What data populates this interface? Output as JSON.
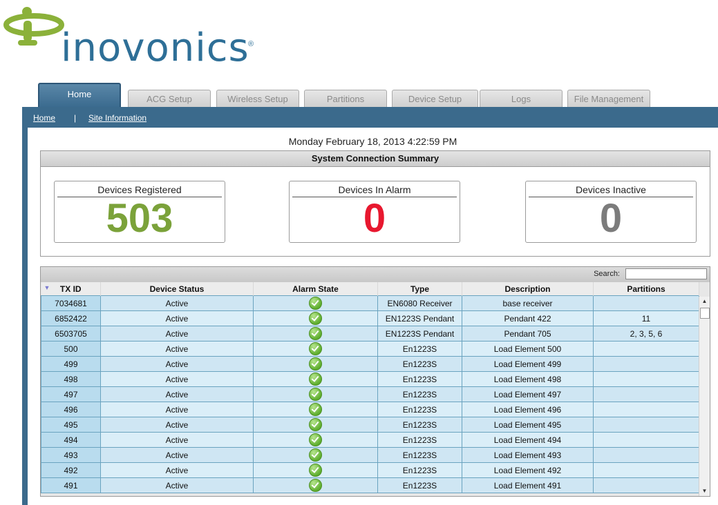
{
  "brand": {
    "name": "inovonics",
    "registered": "®",
    "primary_color": "#2e6f97",
    "accent_color": "#8bb13a"
  },
  "tabs": [
    {
      "label": "Home",
      "active": true
    },
    {
      "label": "ACG Setup"
    },
    {
      "label": "Wireless Setup"
    },
    {
      "label": "Partitions"
    },
    {
      "label": "Device Setup"
    },
    {
      "label": "Logs"
    },
    {
      "label": "File Management"
    }
  ],
  "breadcrumb": {
    "home": "Home",
    "separator": "|",
    "site_information": "Site Information"
  },
  "datetime": "Monday February 18, 2013   4:22:59 PM",
  "summary": {
    "title": "System Connection Summary",
    "cards": [
      {
        "title": "Devices Registered",
        "value": "503",
        "color": "#7ba23a"
      },
      {
        "title": "Devices In Alarm",
        "value": "0",
        "color": "#e8182f"
      },
      {
        "title": "Devices Inactive",
        "value": "0",
        "color": "#7c7c7c"
      }
    ]
  },
  "table": {
    "search_label": "Search:",
    "search_value": "",
    "columns": [
      "TX ID",
      "Device Status",
      "Alarm State",
      "Type",
      "Description",
      "Partitions"
    ],
    "rows": [
      [
        "7034681",
        "Active",
        "ok",
        "EN6080 Receiver",
        "base receiver",
        ""
      ],
      [
        "6852422",
        "Active",
        "ok",
        "EN1223S Pendant",
        "Pendant 422",
        "11"
      ],
      [
        "6503705",
        "Active",
        "ok",
        "EN1223S Pendant",
        "Pendant 705",
        "2, 3, 5, 6"
      ],
      [
        "500",
        "Active",
        "ok",
        "En1223S",
        "Load Element 500",
        ""
      ],
      [
        "499",
        "Active",
        "ok",
        "En1223S",
        "Load Element 499",
        ""
      ],
      [
        "498",
        "Active",
        "ok",
        "En1223S",
        "Load Element 498",
        ""
      ],
      [
        "497",
        "Active",
        "ok",
        "En1223S",
        "Load Element 497",
        ""
      ],
      [
        "496",
        "Active",
        "ok",
        "En1223S",
        "Load Element 496",
        ""
      ],
      [
        "495",
        "Active",
        "ok",
        "En1223S",
        "Load Element 495",
        ""
      ],
      [
        "494",
        "Active",
        "ok",
        "En1223S",
        "Load Element 494",
        ""
      ],
      [
        "493",
        "Active",
        "ok",
        "En1223S",
        "Load Element 493",
        ""
      ],
      [
        "492",
        "Active",
        "ok",
        "En1223S",
        "Load Element 492",
        ""
      ],
      [
        "491",
        "Active",
        "ok",
        "En1223S",
        "Load Element 491",
        ""
      ]
    ]
  }
}
